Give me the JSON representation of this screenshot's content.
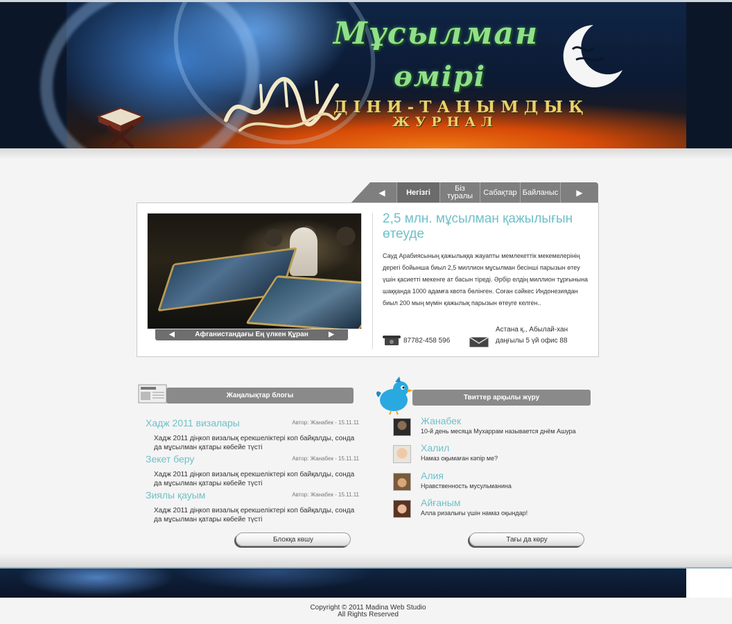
{
  "header": {
    "logo_line1": "Мұсылман",
    "logo_line2": "өмірі",
    "subtitle_line1": "ДІНИ-ТАНЫМДЫҚ",
    "subtitle_line2": "ЖУРНАЛ"
  },
  "nav": {
    "prev_arrow": "◀",
    "next_arrow": "▶",
    "items": [
      {
        "label": "Негізгі"
      },
      {
        "label": "Біз\nтуралы"
      },
      {
        "label": "Сабақтар"
      },
      {
        "label": "Байланыс"
      }
    ]
  },
  "featured": {
    "slide_caption": "Афганистандағы Ең үлкен Құран",
    "prev_arrow": "◀",
    "next_arrow": "▶",
    "title": "2,5 млн. мұсылман қажылығын өтеуде",
    "text": "Сауд Арабиясының қажылыққа жауапты мемлекеттік мекемелерінің дерегі бойынша биыл 2,5 миллион мұсылман бесінші парызын өтеу үшін қасиетті мекенге ат басын тіреді. Әрбір елдің миллион тұрғынына шаққанда 1000 адамға квота бөлінген. Соған сәйкес Индонезиядан биыл 200 мың мүмін қажылық парызын өтеуге келген..",
    "phone": "87782-458 596",
    "address": "Астана қ., Абылай-хан даңғылы 5 үй офис 88"
  },
  "news": {
    "header": "Жаңалықтар блогы",
    "items": [
      {
        "title": "Хадж 2011 визалары",
        "meta": "Автор: Жанабек - 15.11.11",
        "text": "Хадж 2011 діңкоп визалық ерекшеліктері коп байқалды, сонда да мұсылман қатары көбейе түсті"
      },
      {
        "title": "Зекет беру",
        "meta": "Автор: Жанабек - 15.11.11",
        "text": "Хадж 2011 діңкоп визалық ерекшеліктері коп байқалды, сонда да мұсылман қатары көбейе түсті"
      },
      {
        "title": "Зиялы қауым",
        "meta": "Автор: Жанабек - 15.11.11",
        "text": "Хадж 2011 діңкоп визалық ерекшеліктері коп байқалды, сонда да мұсылман қатары көбейе түсті"
      }
    ],
    "button": "Блокқа көшу"
  },
  "twitter": {
    "header": "Твиттер арқылы жүру",
    "items": [
      {
        "name": "Жанабек",
        "message": "10-й день месяца Мухаррам называется днём Ашура"
      },
      {
        "name": "Халил",
        "message": "Намаз оқымаған кәпір ме?"
      },
      {
        "name": "Алия",
        "message": "Нравственность мусульманина"
      },
      {
        "name": "Айғаным",
        "message": "Алла ризалығы үшін намаз оқындар!"
      }
    ],
    "button": "Тағы да көру"
  },
  "footer": {
    "copyright_line1": "Copyright © 2011 Madina Web Studio",
    "copyright_line2": "All Rights Reserved"
  },
  "colors": {
    "accent_teal": "#6fc0c8",
    "bar_gray": "#8a8a8a",
    "logo_green": "#8fe08a",
    "subtitle_gold": "#e8d36a"
  }
}
